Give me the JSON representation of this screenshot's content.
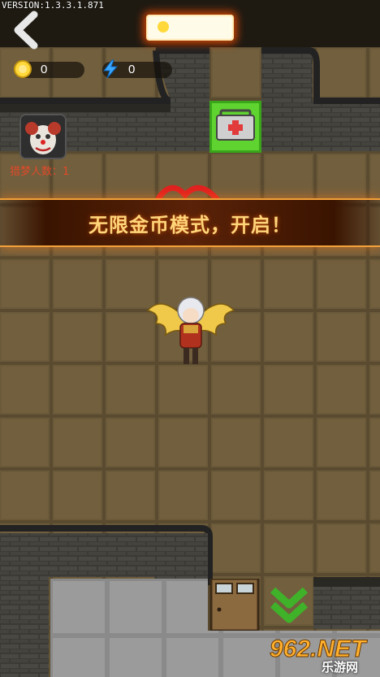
{
  "version_text": "VERSION:1.3.3.1.871",
  "hud": {
    "coins": "0",
    "energy": "0",
    "title_plate": ""
  },
  "hunter_label": "猎梦人数：1",
  "banner_text": "无限金币模式，开启！",
  "watermark": {
    "brand": "962.NET",
    "sub": "乐游网"
  },
  "colors": {
    "floor_tile": "#6b5a3a",
    "wall": "#3a3a35",
    "accent_orange": "#f2a13a",
    "medkit_tile": "#5fd32f",
    "label_red": "#e14a2a"
  },
  "icons": {
    "back": "chevron-left-icon",
    "coin": "coin-icon",
    "energy": "lightning-icon",
    "medkit": "medkit-icon",
    "door": "door-icon",
    "exit": "double-chevron-down-icon"
  }
}
